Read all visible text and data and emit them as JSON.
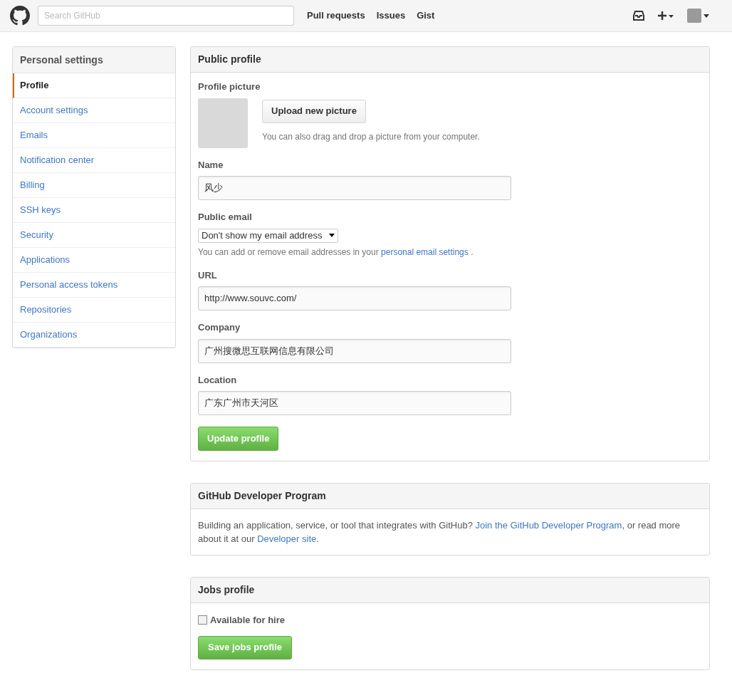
{
  "header": {
    "search": {
      "placeholder": "Search GitHub"
    },
    "nav": [
      "Pull requests",
      "Issues",
      "Gist"
    ]
  },
  "sidebar": {
    "title": "Personal settings",
    "items": [
      {
        "label": "Profile",
        "selected": true
      },
      {
        "label": "Account settings",
        "selected": false
      },
      {
        "label": "Emails",
        "selected": false
      },
      {
        "label": "Notification center",
        "selected": false
      },
      {
        "label": "Billing",
        "selected": false
      },
      {
        "label": "SSH keys",
        "selected": false
      },
      {
        "label": "Security",
        "selected": false
      },
      {
        "label": "Applications",
        "selected": false
      },
      {
        "label": "Personal access tokens",
        "selected": false
      },
      {
        "label": "Repositories",
        "selected": false
      },
      {
        "label": "Organizations",
        "selected": false
      }
    ]
  },
  "public_profile": {
    "title": "Public profile",
    "picture_label": "Profile picture",
    "upload_button": "Upload new picture",
    "upload_hint": "You can also drag and drop a picture from your computer.",
    "name": {
      "label": "Name",
      "value": "风少"
    },
    "public_email": {
      "label": "Public email",
      "value": "Don't show my email address",
      "hint": "You can add or remove email addresses in your",
      "hint_link": "personal email settings",
      "hint_end": "."
    },
    "url": {
      "label": "URL",
      "value": "http://www.souvc.com/"
    },
    "company": {
      "label": "Company",
      "value": "广州搜微思互联网信息有限公司"
    },
    "location": {
      "label": "Location",
      "value": "广东广州市天河区"
    },
    "submit": "Update profile"
  },
  "developer_program": {
    "title": "GitHub Developer Program",
    "segments": [
      {
        "kind": "text",
        "text": "Building an application, service, or tool that integrates with GitHub? "
      },
      {
        "kind": "link",
        "text": "Join the GitHub Developer Program"
      },
      {
        "kind": "text",
        "text": ", or read more about it at our "
      },
      {
        "kind": "link",
        "text": "Developer site"
      },
      {
        "kind": "text",
        "text": "."
      }
    ]
  },
  "jobs_profile": {
    "title": "Jobs profile",
    "available_for_hire": {
      "label": "Available for hire",
      "checked": false
    },
    "submit": "Save jobs profile"
  }
}
